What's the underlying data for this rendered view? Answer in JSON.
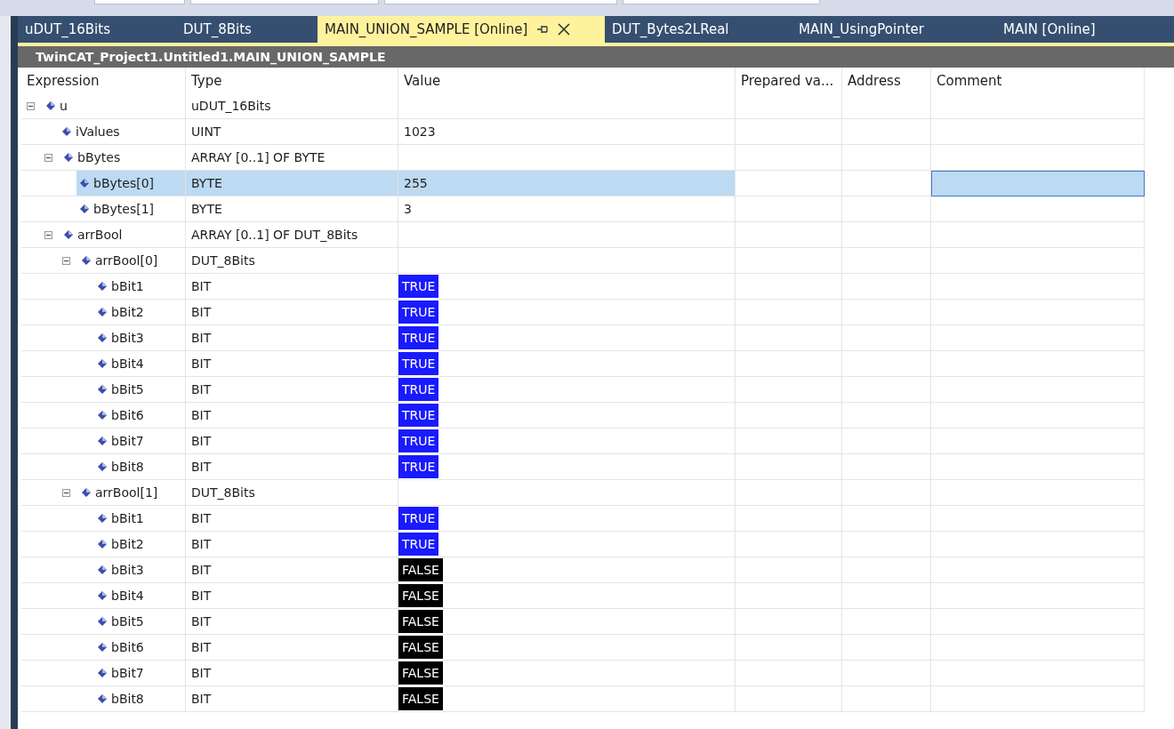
{
  "tabs": [
    {
      "label": "uDUT_16Bits",
      "selected": false
    },
    {
      "label": "DUT_8Bits",
      "selected": false
    },
    {
      "label": "MAIN_UNION_SAMPLE [Online]",
      "selected": true
    },
    {
      "label": "DUT_Bytes2LReal",
      "selected": false
    },
    {
      "label": "MAIN_UsingPointer",
      "selected": false
    },
    {
      "label": "MAIN [Online]",
      "selected": false
    }
  ],
  "path_title": "TwinCAT_Project1.Untitled1.MAIN_UNION_SAMPLE",
  "table": {
    "columns": [
      "Expression",
      "Type",
      "Value",
      "Prepared va...",
      "Address",
      "Comment"
    ],
    "rows": [
      {
        "expression": "u",
        "type": "uDUT_16Bits",
        "expanded": true,
        "selected": false,
        "children": [
          {
            "expression": "iValues",
            "type": "UINT",
            "value": "1023",
            "selected": false
          },
          {
            "expression": "bBytes",
            "type": "ARRAY [0..1] OF BYTE",
            "expanded": true,
            "selected": false,
            "children": [
              {
                "expression": "bBytes[0]",
                "type": "BYTE",
                "value": "255",
                "selected": true
              },
              {
                "expression": "bBytes[1]",
                "type": "BYTE",
                "value": "3",
                "selected": false
              }
            ]
          },
          {
            "expression": "arrBool",
            "type": "ARRAY [0..1] OF DUT_8Bits",
            "expanded": true,
            "selected": false,
            "children": [
              {
                "expression": "arrBool[0]",
                "type": "DUT_8Bits",
                "expanded": true,
                "selected": false,
                "children": [
                  {
                    "expression": "bBit1",
                    "type": "BIT",
                    "value": "TRUE",
                    "bool": true,
                    "selected": false
                  },
                  {
                    "expression": "bBit2",
                    "type": "BIT",
                    "value": "TRUE",
                    "bool": true,
                    "selected": false
                  },
                  {
                    "expression": "bBit3",
                    "type": "BIT",
                    "value": "TRUE",
                    "bool": true,
                    "selected": false
                  },
                  {
                    "expression": "bBit4",
                    "type": "BIT",
                    "value": "TRUE",
                    "bool": true,
                    "selected": false
                  },
                  {
                    "expression": "bBit5",
                    "type": "BIT",
                    "value": "TRUE",
                    "bool": true,
                    "selected": false
                  },
                  {
                    "expression": "bBit6",
                    "type": "BIT",
                    "value": "TRUE",
                    "bool": true,
                    "selected": false
                  },
                  {
                    "expression": "bBit7",
                    "type": "BIT",
                    "value": "TRUE",
                    "bool": true,
                    "selected": false
                  },
                  {
                    "expression": "bBit8",
                    "type": "BIT",
                    "value": "TRUE",
                    "bool": true,
                    "selected": false
                  }
                ]
              },
              {
                "expression": "arrBool[1]",
                "type": "DUT_8Bits",
                "expanded": true,
                "selected": false,
                "children": [
                  {
                    "expression": "bBit1",
                    "type": "BIT",
                    "value": "TRUE",
                    "bool": true,
                    "selected": false
                  },
                  {
                    "expression": "bBit2",
                    "type": "BIT",
                    "value": "TRUE",
                    "bool": true,
                    "selected": false
                  },
                  {
                    "expression": "bBit3",
                    "type": "BIT",
                    "value": "FALSE",
                    "bool": false,
                    "selected": false
                  },
                  {
                    "expression": "bBit4",
                    "type": "BIT",
                    "value": "FALSE",
                    "bool": false,
                    "selected": false
                  },
                  {
                    "expression": "bBit5",
                    "type": "BIT",
                    "value": "FALSE",
                    "bool": false,
                    "selected": false
                  },
                  {
                    "expression": "bBit6",
                    "type": "BIT",
                    "value": "FALSE",
                    "bool": false,
                    "selected": false
                  },
                  {
                    "expression": "bBit7",
                    "type": "BIT",
                    "value": "FALSE",
                    "bool": false,
                    "selected": false
                  },
                  {
                    "expression": "bBit8",
                    "type": "BIT",
                    "value": "FALSE",
                    "bool": false,
                    "selected": false
                  }
                ]
              }
            ]
          }
        ]
      }
    ]
  }
}
